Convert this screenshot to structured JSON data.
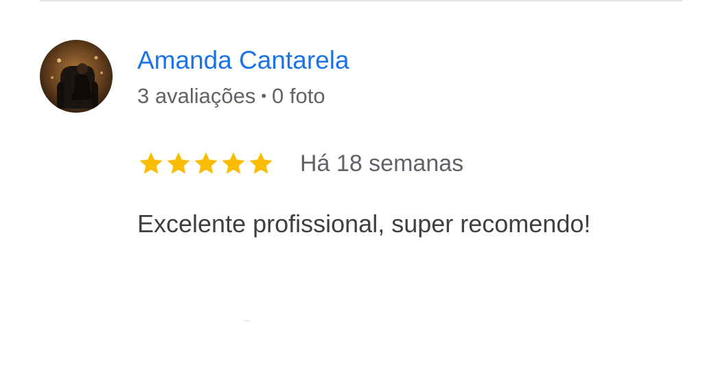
{
  "review": {
    "author": {
      "name": "Amanda Cantarela",
      "reviews_count": "3 avaliações",
      "separator": "•",
      "photos_count": "0 foto"
    },
    "rating": {
      "value": 5,
      "max": 5,
      "star_icon": "star-icon",
      "star_color": "#fbbc04"
    },
    "time": "Há 18 semanas",
    "text": "Excelente profissional, super recomendo!"
  },
  "colors": {
    "author_link": "#1a73e8",
    "meta_text": "#5f6368",
    "body_text": "#3c4043",
    "divider": "#e3e3e3"
  }
}
